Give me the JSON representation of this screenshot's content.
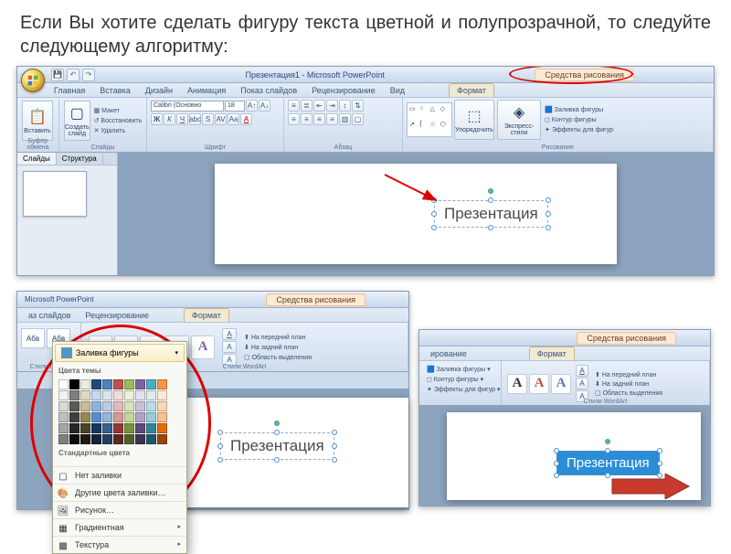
{
  "page": {
    "title": "Если Вы хотите сделать фигуру текста цветной и полупрозрачной, то следуйте следующему алгоритму:"
  },
  "app": {
    "window_title": "Презентация1 - Microsoft PowerPoint",
    "drawing_tools": "Средства рисования",
    "app_name": "Microsoft PowerPoint"
  },
  "ribbon": {
    "tabs": {
      "home": "Главная",
      "insert": "Вставка",
      "design": "Дизайн",
      "animation": "Анимация",
      "slideshow": "Показ слайдов",
      "review": "Рецензирование",
      "view": "Вид",
      "format": "Формат"
    },
    "groups": {
      "clipboard": "Буфер обмена",
      "slides": "Слайды",
      "font": "Шрифт",
      "paragraph": "Абзац",
      "drawing": "Рисование",
      "wordart_styles": "Стили WordArt",
      "shape_styles": "Стили фигур"
    },
    "buttons": {
      "paste": "Вставить",
      "new_slide": "Создать слайд",
      "layout": "Макет",
      "reset": "Восстановить",
      "delete": "Удалить",
      "arrange": "Упорядочить",
      "quick_styles": "Экспресс-стили",
      "shape_fill": "Заливка фигуры",
      "shape_outline": "Контур фигуры",
      "shape_effects": "Эффекты для фигур",
      "bring_front": "На передний план",
      "send_back": "На задний план",
      "selection_pane": "Область выделения"
    },
    "font_name": "Calibri (Основно",
    "font_size": "18"
  },
  "sidebar": {
    "tab_slides": "Слайды",
    "tab_outline": "Структура"
  },
  "content": {
    "textbox_text": "Презентация"
  },
  "shot2": {
    "tab_review": "Рецензирование",
    "tab_slideshow": "аз слайдов",
    "abc": "Абв"
  },
  "color_popup": {
    "shape_fill": "Заливка фигуры",
    "theme_colors": "Цвета темы",
    "standard_colors": "Стандартные цвета",
    "no_fill": "Нет заливки",
    "more_colors": "Другие цвета заливки…",
    "picture": "Рисунок…",
    "gradient": "Градиентная",
    "texture": "Текстура",
    "theme_palette": [
      [
        "#ffffff",
        "#000000",
        "#eeece1",
        "#1f497d",
        "#4f81bd",
        "#c0504d",
        "#9bbb59",
        "#8064a2",
        "#4bacc6",
        "#f79646"
      ],
      [
        "#f2f2f2",
        "#7f7f7f",
        "#ddd9c3",
        "#c6d9f0",
        "#dbe5f1",
        "#f2dcdb",
        "#ebf1dd",
        "#e5e0ec",
        "#dbeef3",
        "#fdeada"
      ],
      [
        "#d8d8d8",
        "#595959",
        "#c4bd97",
        "#8db3e2",
        "#b8cce4",
        "#e5b9b7",
        "#d7e3bc",
        "#ccc1d9",
        "#b7dde8",
        "#fbd5b5"
      ],
      [
        "#bfbfbf",
        "#3f3f3f",
        "#938953",
        "#548dd4",
        "#95b3d7",
        "#d99694",
        "#c3d69b",
        "#b2a2c7",
        "#92cddc",
        "#fac08f"
      ],
      [
        "#a5a5a5",
        "#262626",
        "#494429",
        "#17365d",
        "#366092",
        "#953734",
        "#76923c",
        "#5f497a",
        "#31859b",
        "#e36c09"
      ],
      [
        "#7f7f7f",
        "#0c0c0c",
        "#1d1b10",
        "#0f243e",
        "#244061",
        "#632423",
        "#4f6128",
        "#3f3151",
        "#205867",
        "#974806"
      ]
    ],
    "standard_palette": [
      "#c00000",
      "#ff0000",
      "#ffc000",
      "#ffff00",
      "#92d050",
      "#00b050",
      "#00b0f0",
      "#0070c0",
      "#002060",
      "#7030a0"
    ]
  },
  "next_arrow_color": "#c73a2e"
}
